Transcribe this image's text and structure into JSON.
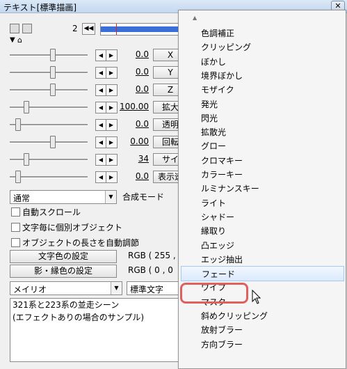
{
  "window": {
    "title": "テキスト[標準描画]",
    "close": "✕"
  },
  "toolbar": {
    "frame": "2",
    "prev_glyph": "◀◀"
  },
  "rows": [
    {
      "value": "0.0",
      "label": "X"
    },
    {
      "value": "0.0",
      "label": "Y"
    },
    {
      "value": "0.0",
      "label": "Z"
    },
    {
      "value": "100.00",
      "label": "拡大"
    },
    {
      "value": "0.0",
      "label": "透明"
    },
    {
      "value": "0.00",
      "label": "回転"
    },
    {
      "value": "34",
      "label": "サイ"
    },
    {
      "value": "0.0",
      "label": "表示速"
    }
  ],
  "blend": {
    "value": "通常",
    "label": "合成モード"
  },
  "options": [
    {
      "label": "自動スクロール"
    },
    {
      "label": "文字毎に個別オブジェクト"
    },
    {
      "label": "オブジェクトの長さを自動調節"
    }
  ],
  "color_buttons": [
    {
      "label": "文字色の設定",
      "rgb": "RGB ( 255 ,"
    },
    {
      "label": "影・縁色の設定",
      "rgb": "RGB ( 0 , 0"
    }
  ],
  "font": {
    "value": "メイリオ",
    "style": "標準文字"
  },
  "text_content": [
    "321系と223系の並走シーン",
    "(エフェクトありの場合のサンプル)"
  ],
  "menu": {
    "items": [
      "色調補正",
      "クリッピング",
      "ぼかし",
      "境界ぼかし",
      "モザイク",
      "発光",
      "閃光",
      "拡散光",
      "グロー",
      "クロマキー",
      "カラーキー",
      "ルミナンスキー",
      "ライト",
      "シャドー",
      "縁取り",
      "凸エッジ",
      "エッジ抽出",
      "フェード",
      "ワイプ",
      "マスク",
      "斜めクリッピング",
      "放射ブラー",
      "方向ブラー"
    ],
    "selected": "フェード"
  }
}
